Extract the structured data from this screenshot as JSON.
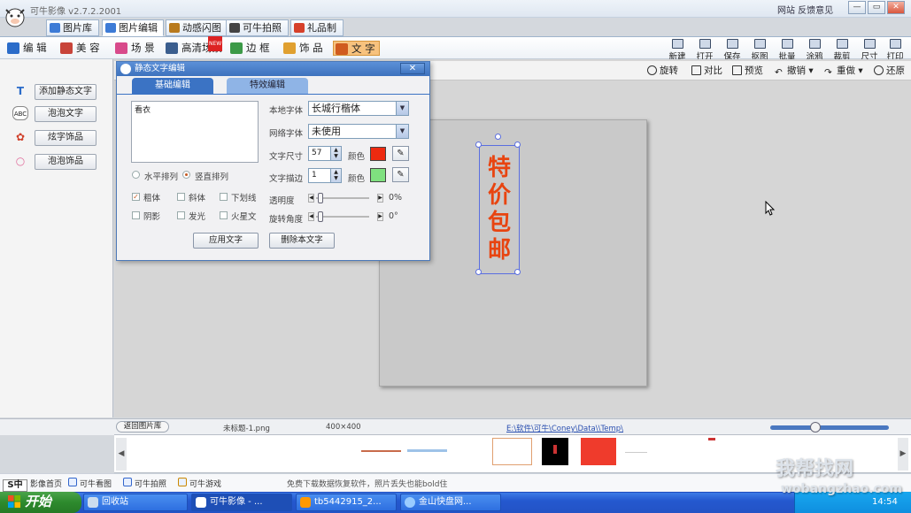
{
  "app": {
    "title": "可牛影像 v2.7.2.2001",
    "top_links": "网站  反馈意见",
    "win_buttons": [
      "—",
      "▭",
      "✕"
    ]
  },
  "main_tabs": [
    {
      "label": "图片库",
      "color": "#3d7bd6"
    },
    {
      "label": "图片编辑",
      "color": "#3d7bd6",
      "active": true
    },
    {
      "label": "动感闪图",
      "color": "#b87a1e"
    },
    {
      "label": "可牛拍照",
      "color": "#444444"
    },
    {
      "label": "礼品制作",
      "color": "#d6402a"
    }
  ],
  "edit_tools": [
    {
      "label": "编 辑",
      "color": "#2b6cc9"
    },
    {
      "label": "美 容",
      "color": "#c8443a"
    },
    {
      "label": "场 景",
      "color": "#d84a8b"
    },
    {
      "label": "高清场景",
      "color": "#3b5e8e",
      "badge": "NEW"
    },
    {
      "label": "边 框",
      "color": "#3c9a48"
    },
    {
      "label": "饰 品",
      "color": "#e0a030"
    },
    {
      "label": "文 字",
      "color": "#d05b1f",
      "active": true
    }
  ],
  "file_tools": [
    "新建",
    "打开",
    "保存",
    "抠图",
    "批量",
    "涂鸦",
    "裁剪",
    "尺寸",
    "打印"
  ],
  "left_panel": {
    "items": [
      {
        "label": "添加静态文字",
        "icon": "T"
      },
      {
        "label": "泡泡文字",
        "icon": "ABC"
      },
      {
        "label": "炫字饰品",
        "icon": "✿"
      },
      {
        "label": "泡泡饰品",
        "icon": "○"
      }
    ]
  },
  "edit_bar": [
    "旋转",
    "对比",
    "预览",
    "撤销",
    "重做",
    "还原"
  ],
  "dialog": {
    "title": "静态文字编辑",
    "tabs": [
      "基础编辑",
      "特效编辑"
    ],
    "text_value": "看衣",
    "layout": {
      "horizontal": "水平排列",
      "vertical": "竖直排列"
    },
    "styles": [
      "粗体",
      "斜体",
      "下划线",
      "阴影",
      "发光",
      "火星文"
    ],
    "local_font_label": "本地字体",
    "local_font_value": "长城行楷体",
    "web_font_label": "网络字体",
    "web_font_value": "未使用",
    "size_label": "文字尺寸",
    "size_value": "57",
    "color_label": "颜色",
    "text_color": "#ee2a10",
    "stroke_label": "文字描边",
    "stroke_value": "1",
    "stroke_color": "#7fe07f",
    "opacity_label": "透明度",
    "opacity_value": "0%",
    "rotate_label": "旋转角度",
    "rotate_value": "0°",
    "apply_button": "应用文字",
    "delete_button": "删除本文字"
  },
  "canvas_text": [
    "特",
    "价",
    "包",
    "邮"
  ],
  "status": {
    "back": "返回图片库",
    "filename": "未标题-1.png",
    "size": "400×400",
    "path": "E:\\软件\\可牛\\Coney\\Data\\\\Temp\\"
  },
  "bottom_links": [
    "影像首页",
    "可牛看图",
    "可牛拍照",
    "可牛游戏"
  ],
  "notice": "免费下载数据恢复软件，照片丢失也能bold住",
  "taskbar": {
    "start": "开始",
    "tasks": [
      "回收站",
      "可牛影像 - ...",
      "tb5442915_2...",
      "金山快盘网..."
    ],
    "clock": "14:54"
  },
  "ime": "S中",
  "watermark": "我帮找网",
  "watermark_url": "wobangzhao.com"
}
